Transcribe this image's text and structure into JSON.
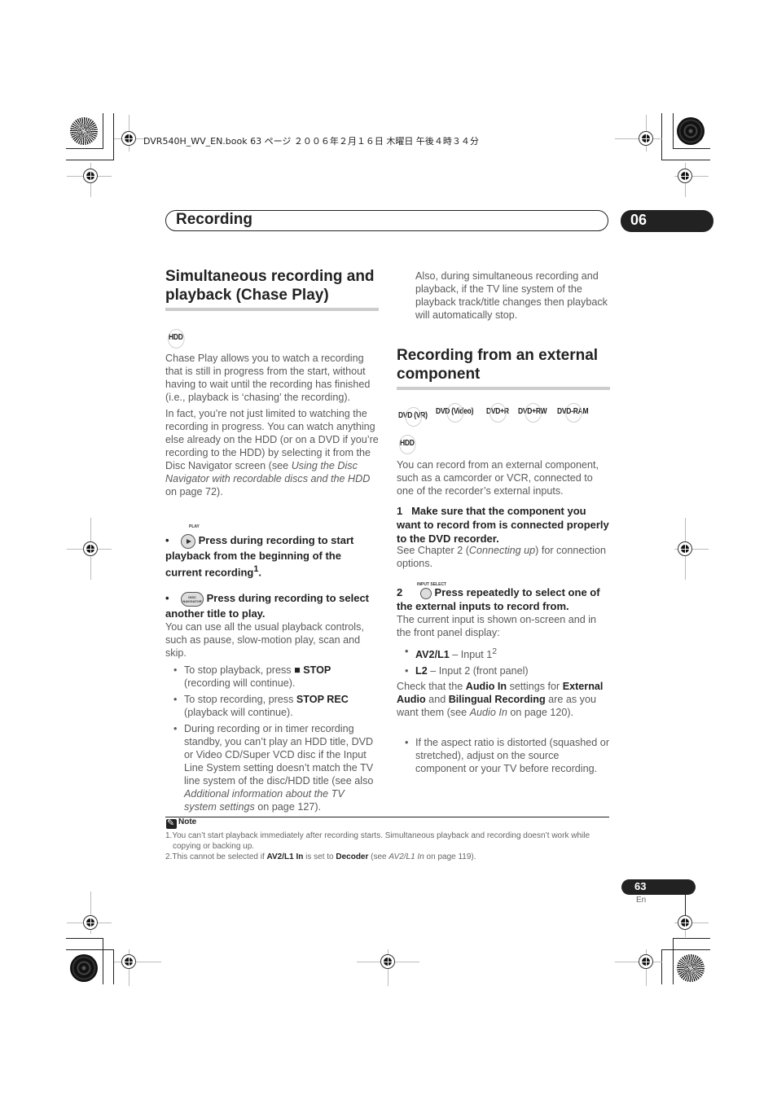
{
  "print_header": "DVR540H_WV_EN.book  63 ページ  ２００６年２月１６日  木曜日  午後４時３４分",
  "chapter": {
    "title": "Recording",
    "number": "06"
  },
  "left_column": {
    "section_title_line1": "Simultaneous recording and",
    "section_title_line2": "playback (Chase Play)",
    "disc_mark": "HDD",
    "para1": "Chase Play allows you to watch a recording that is still in progress from the start, without having to wait until the recording has finished (i.e., playback is ‘chasing’ the recording).",
    "para2_start": "In fact, you’re not just limited to watching the recording in progress. You can watch anything else already on the HDD (or on a DVD if you’re recording to the HDD) by selecting it from the Disc Navigator screen (see ",
    "para2_italic": "Using the Disc Navigator with recordable discs and the HDD",
    "para2_end": " on page 72).",
    "bullet1": {
      "button_label": "PLAY",
      "text": "Press during recording to start playback from the beginning of the current recording",
      "footnote_ref": "1",
      "end": "."
    },
    "bullet2": {
      "button_label_line1": "DISC",
      "button_label_line2": "NAVIGATOR",
      "text": "Press during recording to select another title to play."
    },
    "para3": "You can use all the usual playback controls, such as pause, slow-motion play, scan and skip.",
    "sub_bullets": [
      {
        "pre": "To stop playback, press ",
        "bold": "■ STOP",
        "post": " (recording will continue)."
      },
      {
        "pre": "To stop recording, press ",
        "bold": "STOP REC",
        "post": " (playback will continue)."
      },
      {
        "pre": "During recording or in timer recording standby, you can’t play an HDD title, DVD or Video CD/Super VCD disc if the Input Line System setting doesn’t match the TV line system of the disc/HDD title (see also ",
        "italic": "Additional information about the TV system settings",
        "post": " on page 127)."
      }
    ]
  },
  "right_column": {
    "continued_para": "Also, during simultaneous recording and playback, if the TV line system of the playback track/title changes then playback will automatically stop.",
    "section_title_line1": "Recording from an external",
    "section_title_line2": "component",
    "disc_marks": [
      "DVD (VR)",
      "DVD (Video)",
      "DVD+R",
      "DVD+RW",
      "DVD-RAM"
    ],
    "disc_mark_hdd": "HDD",
    "intro": "You can record from an external component, such as a camcorder or VCR, connected to one of the recorder’s external inputs.",
    "step1": {
      "number": "1",
      "text": "Make sure that the component you want to record from is connected properly to the DVD recorder.",
      "detail_pre": "See Chapter 2 (",
      "detail_italic": "Connecting up",
      "detail_post": ") for connection options."
    },
    "step2": {
      "number": "2",
      "button_label": "INPUT SELECT",
      "text": "Press repeatedly to select one of the external inputs to record from.",
      "detail": "The current input is shown on-screen and in the front panel display:"
    },
    "inputs": [
      {
        "name": "AV2/L1",
        "desc": " – Input 1",
        "sup": "2"
      },
      {
        "name": "L2",
        "desc": " – Input 2 (front panel)",
        "sup": ""
      }
    ],
    "check_para": {
      "t1": "Check that the ",
      "b1": "Audio In",
      "t2": " settings for ",
      "b2": "External Audio",
      "t3": " and ",
      "b3": "Bilingual Recording",
      "t4": " are as you want them (see ",
      "i1": "Audio In",
      "t5": " on page 120)."
    },
    "tip_bullet": "If the aspect ratio is distorted (squashed or stretched), adjust on the source component or your TV before recording."
  },
  "note": {
    "label": "Note",
    "items": [
      {
        "text": "1.You can’t start playback immediately after recording starts. Simultaneous playback and recording doesn’t work while copying or backing up."
      },
      {
        "pre": "2.This cannot be selected if ",
        "b1": "AV2/L1 In",
        "mid": " is set to ",
        "b2": "Decoder",
        "post1": " (see ",
        "i1": "AV2/L1 In",
        "post2": " on page 119)."
      }
    ]
  },
  "footer": {
    "page_number": "63",
    "language": "En"
  }
}
